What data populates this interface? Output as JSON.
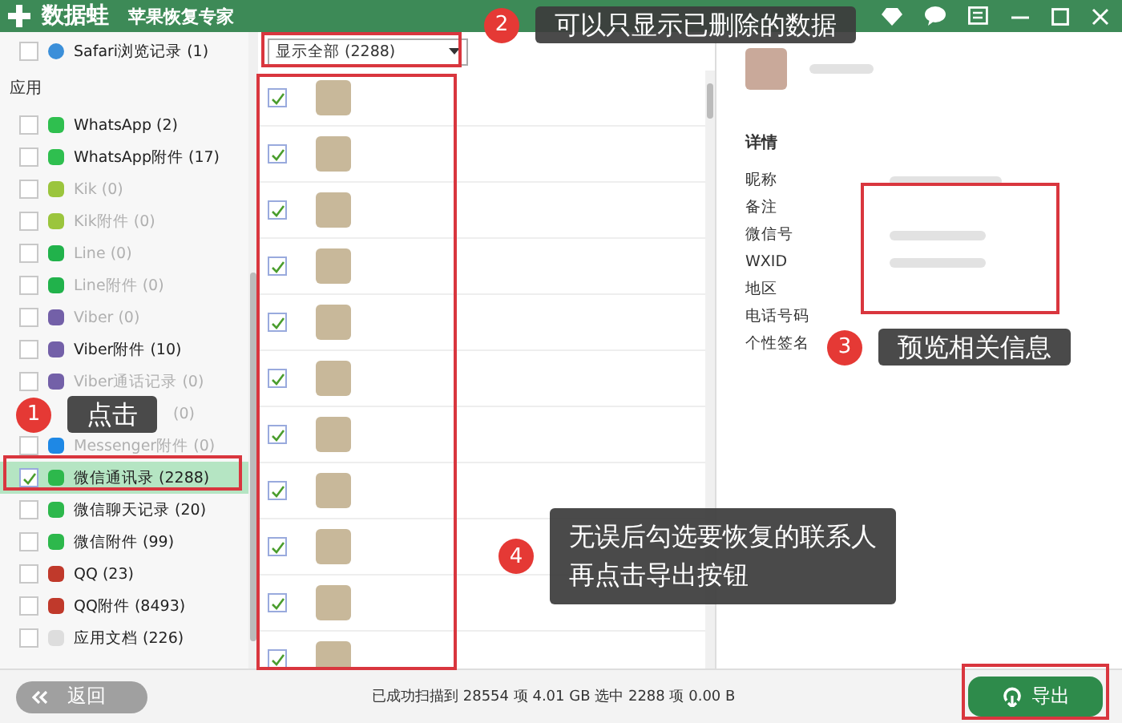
{
  "window": {
    "brand": "数据蛙",
    "title": "苹果恢复专家"
  },
  "sidebar": {
    "top_item": {
      "label": "Safari浏览记录 (1)",
      "checked": false,
      "color": "#3b8fd9"
    },
    "section": "应用",
    "items": [
      {
        "label": "WhatsApp (2)",
        "checked": false,
        "disabled": false,
        "selected": false,
        "color": "#2fbf4f"
      },
      {
        "label": "WhatsApp附件 (17)",
        "checked": false,
        "disabled": false,
        "selected": false,
        "color": "#2fbf4f"
      },
      {
        "label": "Kik (0)",
        "checked": false,
        "disabled": true,
        "selected": false,
        "color": "#9bc53d"
      },
      {
        "label": "Kik附件 (0)",
        "checked": false,
        "disabled": true,
        "selected": false,
        "color": "#9bc53d"
      },
      {
        "label": "Line (0)",
        "checked": false,
        "disabled": true,
        "selected": false,
        "color": "#21b24b"
      },
      {
        "label": "Line附件 (0)",
        "checked": false,
        "disabled": true,
        "selected": false,
        "color": "#21b24b"
      },
      {
        "label": "Viber (0)",
        "checked": false,
        "disabled": true,
        "selected": false,
        "color": "#7360a8"
      },
      {
        "label": "Viber附件 (10)",
        "checked": false,
        "disabled": false,
        "selected": false,
        "color": "#7360a8"
      },
      {
        "label": "Viber通话记录 (0)",
        "checked": false,
        "disabled": true,
        "selected": false,
        "color": "#7360a8"
      },
      {
        "kind": "covered",
        "label": "(0)",
        "disabled": true,
        "selected": false
      },
      {
        "label": "Messenger附件 (0)",
        "checked": false,
        "disabled": true,
        "selected": false,
        "color": "#1e88e5"
      },
      {
        "label": "微信通讯录 (2288)",
        "checked": true,
        "disabled": false,
        "selected": true,
        "color": "#2db84c"
      },
      {
        "label": "微信聊天记录 (20)",
        "checked": false,
        "disabled": false,
        "selected": false,
        "color": "#2db84c"
      },
      {
        "label": "微信附件 (99)",
        "checked": false,
        "disabled": false,
        "selected": false,
        "color": "#2db84c"
      },
      {
        "label": "QQ (23)",
        "checked": false,
        "disabled": false,
        "selected": false,
        "color": "#c0392b"
      },
      {
        "label": "QQ附件 (8493)",
        "checked": false,
        "disabled": false,
        "selected": false,
        "color": "#c0392b"
      },
      {
        "label": "应用文档 (226)",
        "checked": false,
        "disabled": false,
        "selected": false,
        "color": "#dddddd"
      }
    ]
  },
  "filter": {
    "value": "显示全部 (2288)"
  },
  "contacts": [
    {
      "checked": true
    },
    {
      "checked": true
    },
    {
      "checked": true
    },
    {
      "checked": true
    },
    {
      "checked": true
    },
    {
      "checked": true
    },
    {
      "checked": true
    },
    {
      "checked": true
    },
    {
      "checked": true
    },
    {
      "checked": true
    },
    {
      "checked": true
    }
  ],
  "details": {
    "heading": "详情",
    "fields": [
      "昵称",
      "备注",
      "微信号",
      "WXID",
      "地区",
      "电话号码",
      "个性签名"
    ]
  },
  "status_bar": {
    "back": "返回",
    "summary": "已成功扫描到 28554 项 4.01 GB  选中 2288 项 0.00 B",
    "export": "导出"
  },
  "callouts": [
    {
      "number": "1",
      "text": "点击"
    },
    {
      "number": "2",
      "text": "可以只显示已删除的数据"
    },
    {
      "number": "3",
      "text": "预览相关信息"
    },
    {
      "number": "4",
      "lines": [
        "无误后勾选要恢复的联系人",
        "再点击导出按钮"
      ]
    }
  ]
}
